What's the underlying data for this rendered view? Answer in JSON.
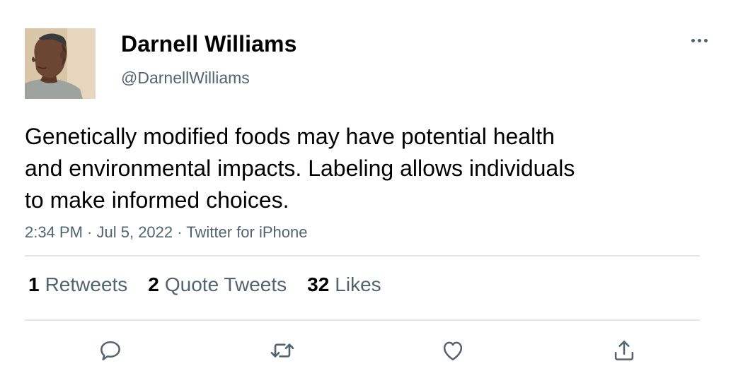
{
  "user": {
    "display_name": "Darnell Williams",
    "handle": "@DarnellWilliams"
  },
  "tweet": {
    "text": "Genetically modified foods may have potential health\nand environmental impacts. Labeling allows individuals\nto make informed choices.",
    "time": "2:34 PM",
    "date": "Jul 5, 2022",
    "source": "Twitter for iPhone",
    "meta_separator": " · "
  },
  "stats": {
    "retweets": {
      "count": "1",
      "label": "Retweets"
    },
    "quote_tweets": {
      "count": "2",
      "label": "Quote Tweets"
    },
    "likes": {
      "count": "32",
      "label": "Likes"
    }
  },
  "icons": {
    "more": "more-horizontal-icon",
    "reply": "reply-icon",
    "retweet": "retweet-icon",
    "like": "heart-icon",
    "share": "share-icon"
  },
  "colors": {
    "text_primary": "#000000",
    "text_secondary": "#536471",
    "divider": "#e1e6e9"
  }
}
